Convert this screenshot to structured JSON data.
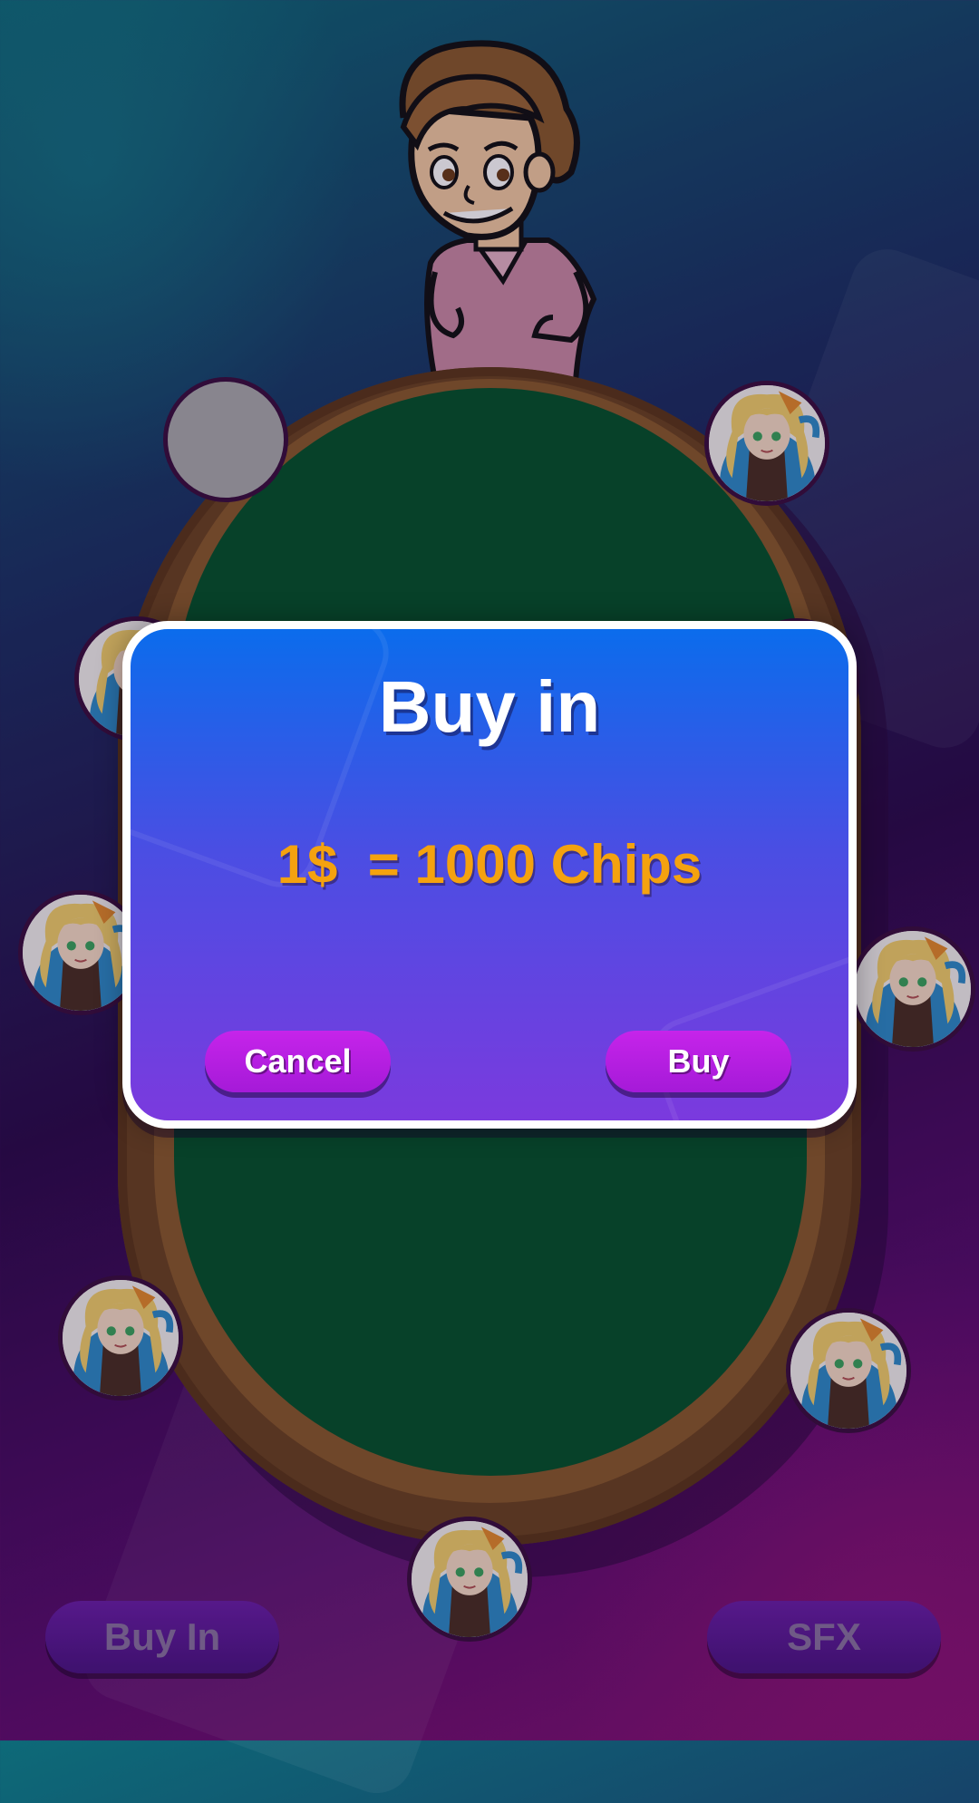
{
  "dialog": {
    "title": "Buy in",
    "rate_text": "1$  = 1000 Chips",
    "cancel_label": "Cancel",
    "buy_label": "Buy"
  },
  "footer": {
    "buy_in_label": "Buy In",
    "sfx_label": "SFX"
  },
  "seats": [
    {
      "status": "empty"
    },
    {
      "status": "occupied",
      "avatar": "anime-girl-avatar"
    },
    {
      "status": "occupied",
      "avatar": "anime-girl-avatar"
    },
    {
      "status": "occupied",
      "avatar": "anime-girl-avatar"
    },
    {
      "status": "occupied",
      "avatar": "anime-girl-avatar"
    },
    {
      "status": "occupied",
      "avatar": "anime-girl-avatar"
    },
    {
      "status": "occupied",
      "avatar": "anime-girl-avatar"
    },
    {
      "status": "occupied",
      "avatar": "anime-girl-avatar"
    }
  ],
  "colors": {
    "felt": "#04522a",
    "rim": "#8a5a2b",
    "dialog_top": "#0b6cec",
    "dialog_bottom": "#7b3ade",
    "button": "#c624ea",
    "rate_text": "#f4a20f"
  },
  "icons": {
    "dealer": "dealer-character",
    "avatar": "anime-girl-avatar"
  }
}
